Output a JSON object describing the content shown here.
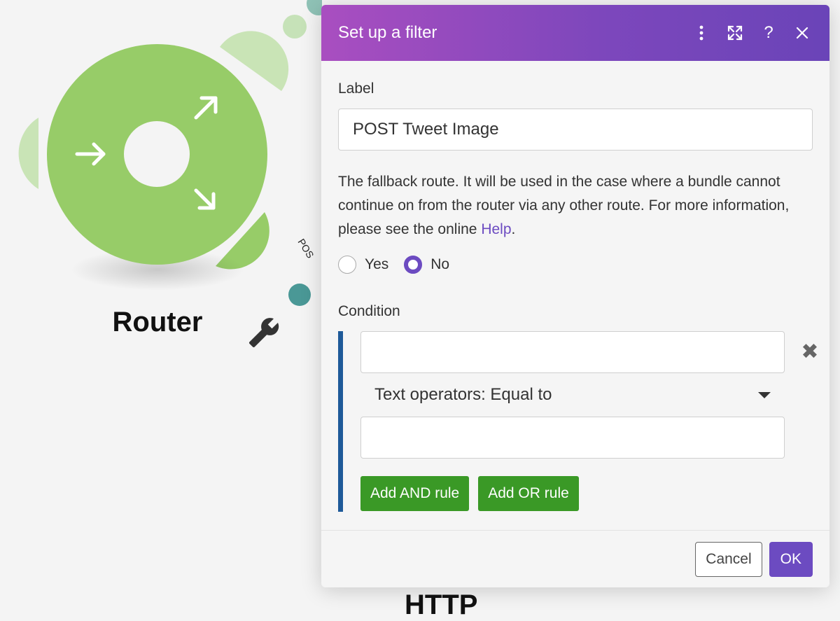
{
  "canvas": {
    "router_title": "Router",
    "route_label": "POS",
    "bottom_label": "HTTP",
    "router_color": "#97cc68",
    "connector_color": "#4a9896"
  },
  "modal": {
    "title": "Set up a filter",
    "header_gradient": [
      "#a94ec0",
      "#6a44b8"
    ],
    "icons": [
      "more-vertical-icon",
      "expand-icon",
      "help-icon",
      "close-icon"
    ],
    "help_glyph": "?",
    "label_field": {
      "label": "Label",
      "value": "POST Tweet Image"
    },
    "fallback": {
      "text_before_link": "The fallback route. It will be used in the case where a bundle cannot continue on from the router via any other route. For more information, please see the online ",
      "link_text": "Help",
      "text_after_link": ".",
      "options": [
        {
          "label": "Yes",
          "selected": false
        },
        {
          "label": "No",
          "selected": true
        }
      ]
    },
    "condition": {
      "label": "Condition",
      "operand_a": "",
      "operator": "Text operators: Equal to",
      "operand_b": "",
      "remove_glyph": "✖",
      "add_and_label": "Add AND rule",
      "add_or_label": "Add OR rule"
    },
    "footer": {
      "cancel_label": "Cancel",
      "ok_label": "OK"
    }
  }
}
